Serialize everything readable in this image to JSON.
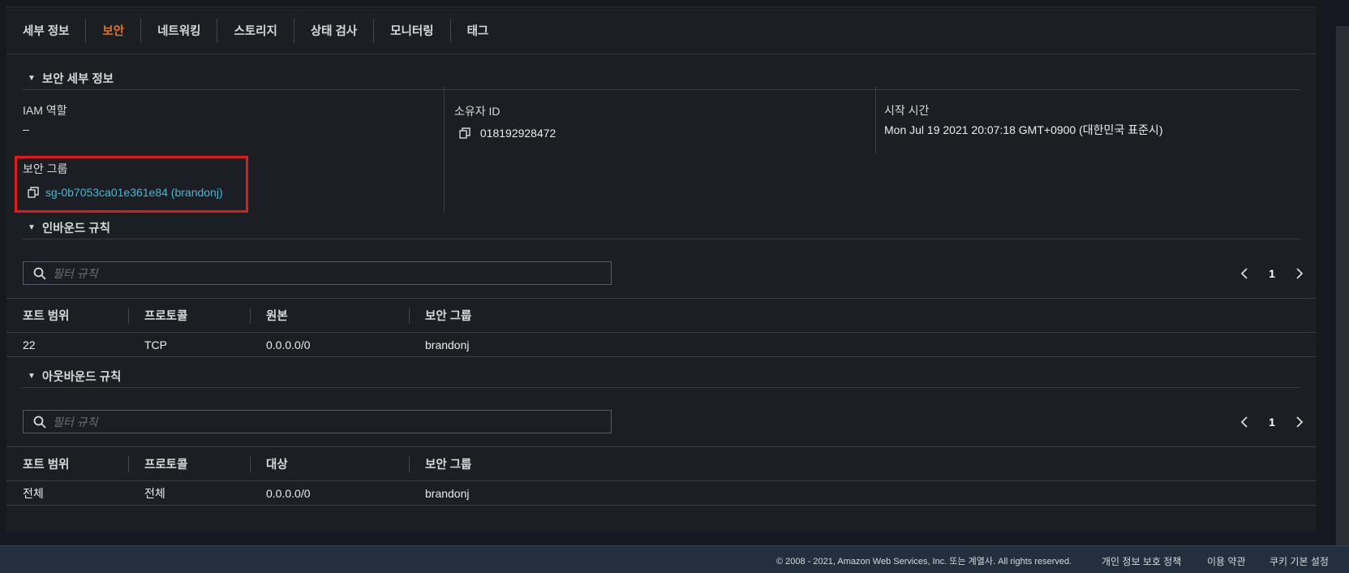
{
  "tabs": [
    {
      "label": "세부 정보",
      "active": false
    },
    {
      "label": "보안",
      "active": true
    },
    {
      "label": "네트워킹",
      "active": false
    },
    {
      "label": "스토리지",
      "active": false
    },
    {
      "label": "상태 검사",
      "active": false
    },
    {
      "label": "모니터링",
      "active": false
    },
    {
      "label": "태그",
      "active": false
    }
  ],
  "security_details": {
    "title": "보안 세부 정보",
    "iam_role_label": "IAM 역할",
    "iam_role_value": "–",
    "owner_id_label": "소유자 ID",
    "owner_id_value": "018192928472",
    "launch_time_label": "시작 시간",
    "launch_time_value": "Mon Jul 19 2021 20:07:18 GMT+0900 (대한민국 표준시)",
    "security_group_label": "보안 그룹",
    "security_group_value": "sg-0b7053ca01e361e84 (brandonj)"
  },
  "inbound": {
    "title": "인바운드 규칙",
    "filter_placeholder": "필터 규칙",
    "page": "1",
    "columns": [
      "포트 범위",
      "프로토콜",
      "원본",
      "보안 그룹"
    ],
    "rows": [
      [
        "22",
        "TCP",
        "0.0.0.0/0",
        "brandonj"
      ]
    ]
  },
  "outbound": {
    "title": "아웃바운드 규칙",
    "filter_placeholder": "필터 규칙",
    "page": "1",
    "columns": [
      "포트 범위",
      "프로토콜",
      "대상",
      "보안 그룹"
    ],
    "rows": [
      [
        "전체",
        "전체",
        "0.0.0.0/0",
        "brandonj"
      ]
    ]
  },
  "footer": {
    "copyright": "© 2008 - 2021, Amazon Web Services, Inc. 또는 계열사. All rights reserved.",
    "privacy": "개인 정보 보호 정책",
    "terms": "이용 약관",
    "cookies": "쿠키 기본 설정"
  },
  "colors": {
    "accent": "#ec7211",
    "link": "#44b9d6",
    "highlight": "#e01b1b"
  }
}
